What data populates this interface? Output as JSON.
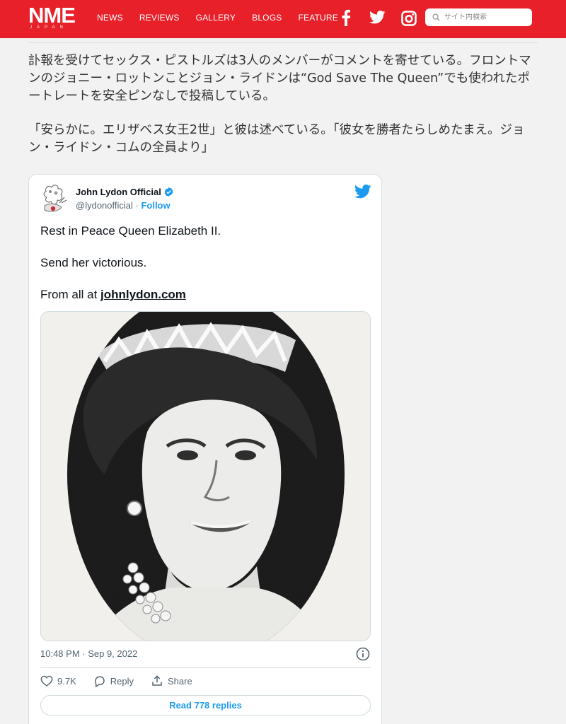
{
  "header": {
    "logo_main": "NME",
    "logo_sub": "JAPAN",
    "nav": [
      "NEWS",
      "REVIEWS",
      "GALLERY",
      "BLOGS",
      "FEATURE"
    ],
    "social_icons": [
      "facebook-icon",
      "twitter-icon",
      "instagram-icon"
    ],
    "search_placeholder": "サイト内検索",
    "brand_color": "#e8202a"
  },
  "article": {
    "paragraph1": "訃報を受けてセックス・ピストルズは3人のメンバーがコメントを寄せている。フロントマンのジョニー・ロットンことジョン・ライドンは“God Save The Queen”でも使われたポートレートを安全ピンなしで投稿している。",
    "paragraph2": "「安らかに。エリザベス女王2世」と彼は述べている。「彼女を勝者たらしめたまえ。ジョン・ライドン・コムの全員より」"
  },
  "tweet": {
    "author_name": "John Lydon Official",
    "handle": "@lydonofficial",
    "separator": " · ",
    "follow_label": "Follow",
    "line1": "Rest in Peace Queen Elizabeth II.",
    "line2": "Send her victorious.",
    "line3_prefix": "From all at ",
    "line3_link": "johnlydon.com",
    "timestamp": "10:48 PM · Sep 9, 2022",
    "like_count": "9.7K",
    "reply_label": "Reply",
    "share_label": "Share",
    "read_replies_label": "Read 778 replies",
    "accent_color": "#1d9bf0"
  }
}
